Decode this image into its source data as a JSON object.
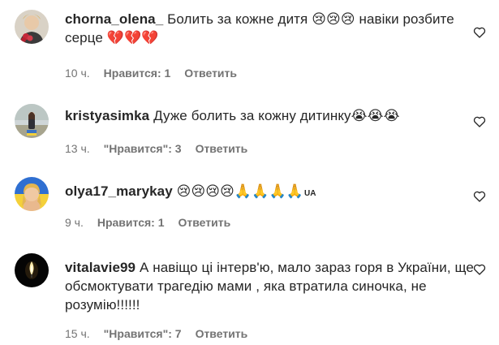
{
  "comments": [
    {
      "username": "chorna_olena_",
      "text": "Болить за кожне дитя",
      "emojis": "😢😢😢",
      "text2": "навіки розбите серце",
      "emojis2": "💔💔💔",
      "time": "10 ч.",
      "likes": "Нравится: 1",
      "reply": "Ответить",
      "avatar": "avatar-photo-flowers"
    },
    {
      "username": "kristyasimka",
      "text": "Дуже болить за кожну дитинку",
      "emojis": "😭😭😭",
      "time": "13 ч.",
      "likes": "\"Нравится\": 3",
      "reply": "Ответить",
      "avatar": "avatar-photo-street"
    },
    {
      "username": "olya17_marykay",
      "text": "",
      "emojis": "😢😢😢😢🙏🙏🙏🙏",
      "flag": "UA",
      "time": "9 ч.",
      "likes": "Нравится: 1",
      "reply": "Ответить",
      "avatar": "avatar-photo-flag"
    },
    {
      "username": "vitalavie99",
      "text": "А навіщо ці інтерв'ю, мало зараз горя в України, ще обсмоктувати трагедію мами , яка втратила синочка, не розумію!!!!!!",
      "time": "15 ч.",
      "likes": "\"Нравится\": 7",
      "reply": "Ответить",
      "avatar": "avatar-candle"
    }
  ],
  "colors": {
    "text": "#262626",
    "meta": "#737373",
    "background": "#ffffff"
  }
}
